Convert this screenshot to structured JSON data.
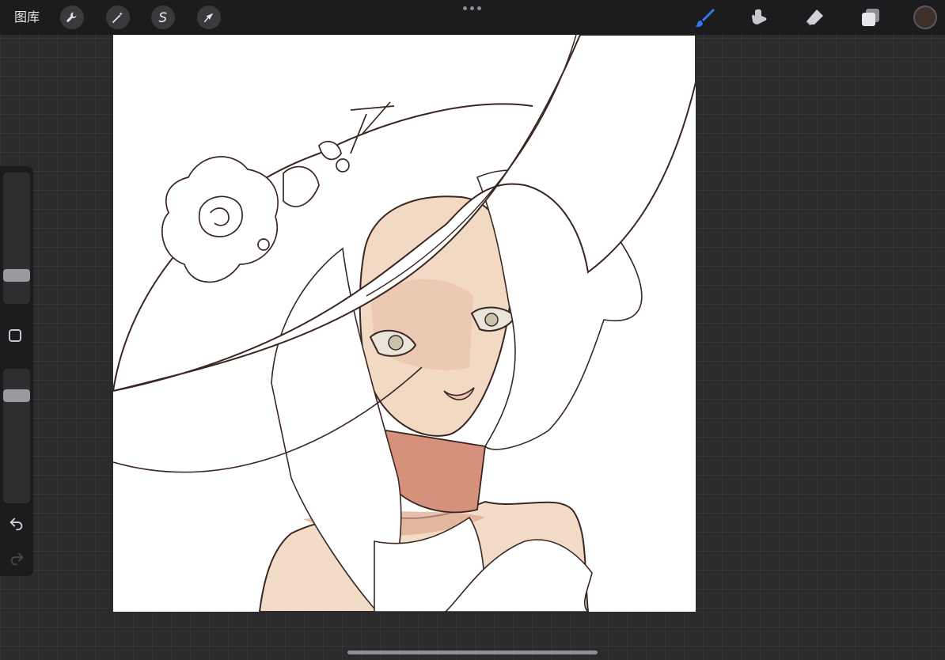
{
  "topbar": {
    "gallery_label": "图库",
    "left_tools": [
      "wrench-icon",
      "magic-wand-icon",
      "selection-icon",
      "transform-arrow-icon"
    ],
    "right_tools": [
      "brush-icon",
      "smudge-icon",
      "eraser-icon",
      "layers-icon"
    ],
    "active_tool": "brush-icon",
    "active_color": "#3d2f2a",
    "accent_color": "#2f7bf5"
  },
  "sidebar": {
    "controls": [
      "brush-size-slider",
      "modify-button",
      "brush-opacity-slider",
      "undo-icon",
      "redo-icon"
    ]
  }
}
